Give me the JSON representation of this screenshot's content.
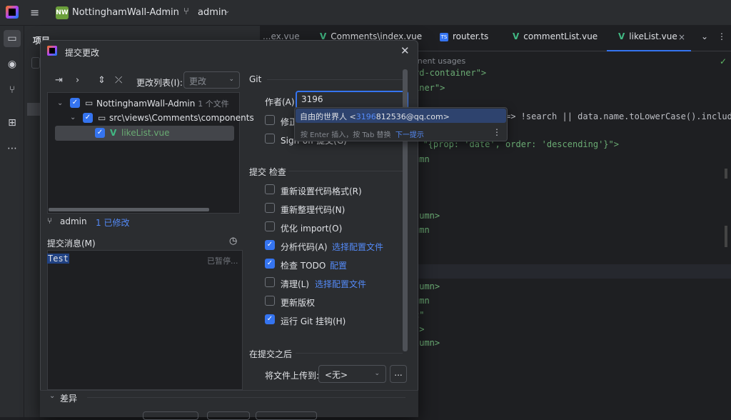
{
  "titlebar": {
    "project_badge": "NW",
    "project_name": "NottinghamWall-Admin",
    "branch": "admin",
    "hamburger": "≡"
  },
  "project_panel": {
    "title": "项目"
  },
  "editor": {
    "tabs": [
      {
        "label": "...ex.vue",
        "icon": "vue-icon"
      },
      {
        "label": "Comments\\index.vue",
        "icon": "vue-icon"
      },
      {
        "label": "router.ts",
        "icon": "ts-icon"
      },
      {
        "label": "commentList.vue",
        "icon": "vue-icon"
      },
      {
        "label": "likeList.vue",
        "icon": "vue-icon",
        "active": true
      }
    ],
    "inlay_hint": "onent usages",
    "code_lines": [
      {
        "frag": "rd-container\">"
      },
      {
        "frag": "iner\">"
      },
      {
        "frag": "=> !search || data.name.toLowerCase().include"
      },
      {
        "frag": "= \"{prop: 'date', order: 'descending'}\">"
      },
      {
        "frag": "umn"
      },
      {
        "frag": "\""
      },
      {
        "frag": "lumn>"
      },
      {
        "frag": "umn"
      },
      {
        "frag": "\""
      },
      {
        "frag": "lumn>"
      },
      {
        "frag": "umn"
      },
      {
        "frag": "c\""
      },
      {
        "frag": "\">"
      },
      {
        "frag": "lumn>"
      }
    ]
  },
  "dialog": {
    "title": "提交更改",
    "changelist_label": "更改列表(I):",
    "changelist_value": "更改",
    "tree": [
      {
        "label": "NottinghamWall-Admin",
        "meta": "1 个文件"
      },
      {
        "label": "src\\views\\Comments\\components",
        "meta": ""
      },
      {
        "label": "likeList.vue",
        "meta": ""
      }
    ],
    "branch": "admin",
    "modified": "1 已修改",
    "message_label": "提交消息(M)",
    "message_text": "Test",
    "saved_text": "已暂停...",
    "diff_label": "差异",
    "git_label": "Git",
    "author_label": "作者(A):",
    "author_value": "3196",
    "amend_label": "修正",
    "signoff_label": "Sign-off 提交(G)",
    "checks_label": "提交 检查",
    "checks": [
      {
        "label": "重新设置代码格式(R)",
        "checked": false,
        "link": ""
      },
      {
        "label": "重新整理代码(N)",
        "checked": false,
        "link": ""
      },
      {
        "label": "优化 import(O)",
        "checked": false,
        "link": ""
      },
      {
        "label": "分析代码(A)",
        "checked": true,
        "link": "选择配置文件"
      },
      {
        "label": "检查 TODO",
        "checked": true,
        "link": "配置"
      },
      {
        "label": "清理(L)",
        "checked": false,
        "link": "选择配置文件"
      },
      {
        "label": "更新版权",
        "checked": false,
        "link": ""
      },
      {
        "label": "运行 Git 挂钩(H)",
        "checked": true,
        "link": ""
      }
    ],
    "after_label": "在提交之后",
    "upload_label": "将文件上传到:",
    "upload_value": "<无>",
    "upload_more": "...",
    "popup": {
      "item_prefix": "自由的世界人 <",
      "item_match": "3196",
      "item_rest": "812536@qq.com>",
      "hint": "按 Enter 插入，按 Tab 替换",
      "next": "下一提示"
    }
  },
  "colors": {
    "accent": "#3574f0",
    "link": "#548af7",
    "vue_green": "#41b883",
    "bg": "#1e1f22",
    "panel": "#2b2d30"
  }
}
